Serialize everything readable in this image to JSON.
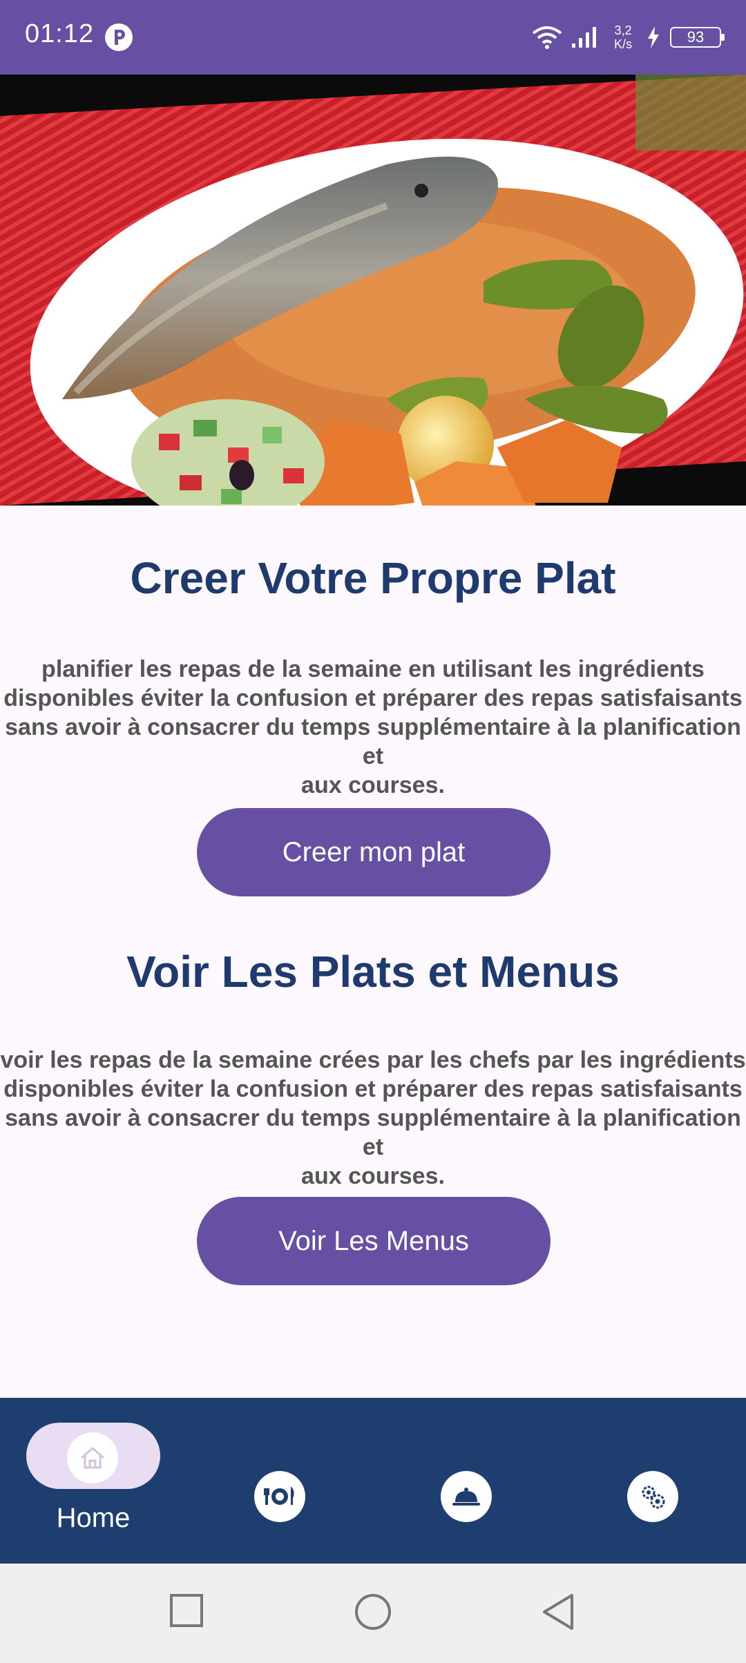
{
  "status_bar": {
    "time": "01:12",
    "net_speed_value": "3,2",
    "net_speed_unit": "K/s",
    "battery_level": "93"
  },
  "sections": [
    {
      "title": "Creer Votre Propre Plat",
      "description": "planifier les repas de la semaine en utilisant les ingrédients\ndisponibles éviter la confusion et préparer des repas satisfaisants\nsans avoir à consacrer du temps supplémentaire à la planification et\naux courses.",
      "button_label": "Creer mon plat"
    },
    {
      "title": "Voir Les Plats et Menus",
      "description": "voir les repas de la semaine crées par les chefs par les ingrédients\ndisponibles éviter la confusion et préparer des repas satisfaisants\nsans avoir à consacrer du temps supplémentaire à la planification et\naux courses.",
      "button_label": "Voir Les Menus"
    }
  ],
  "bottom_nav": {
    "items": [
      {
        "label": "Home",
        "icon": "home-icon",
        "active": true
      },
      {
        "label": "",
        "icon": "plate-cutlery-icon",
        "active": false
      },
      {
        "label": "",
        "icon": "cloche-icon",
        "active": false
      },
      {
        "label": "",
        "icon": "gears-icon",
        "active": false
      }
    ]
  },
  "colors": {
    "primary": "#6750A4",
    "title": "#1E3A6E",
    "nav_background": "#1E3E70",
    "home_pill": "#E9DDF4"
  }
}
